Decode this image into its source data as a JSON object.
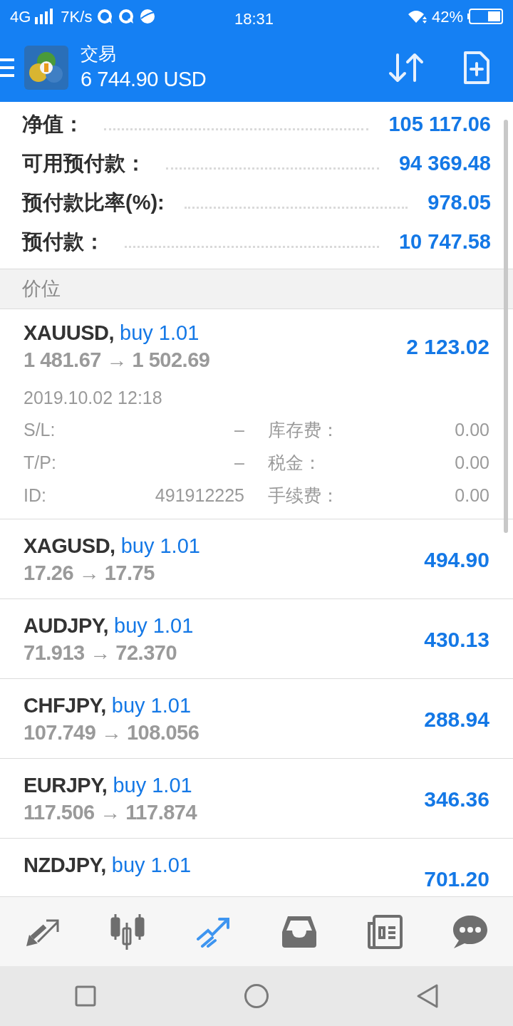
{
  "status_bar": {
    "network": "4G",
    "speed": "7K/s",
    "time": "18:31",
    "battery": "42%"
  },
  "header": {
    "title": "交易",
    "balance": "6 744.90 USD"
  },
  "summary": [
    {
      "label": "净值：",
      "value": "105 117.06"
    },
    {
      "label": "可用预付款：",
      "value": "94 369.48"
    },
    {
      "label": "预付款比率(%):",
      "value": "978.05"
    },
    {
      "label": "预付款：",
      "value": "10 747.58"
    }
  ],
  "section_title": "价位",
  "positions": [
    {
      "symbol": "XAUUSD,",
      "side": "buy 1.01",
      "prices": "1 481.67 → 1 502.69",
      "profit": "2 123.02",
      "expanded": true,
      "time": "2019.10.02 12:18",
      "details": [
        {
          "label": "S/L:",
          "value": "–"
        },
        {
          "label": "库存费：",
          "value": "0.00"
        },
        {
          "label": "T/P:",
          "value": "–"
        },
        {
          "label": "税金：",
          "value": "0.00"
        },
        {
          "label": "ID:",
          "value": "491912225"
        },
        {
          "label": "手续费：",
          "value": "0.00"
        }
      ]
    },
    {
      "symbol": "XAGUSD,",
      "side": "buy 1.01",
      "prices": "17.26 → 17.75",
      "profit": "494.90",
      "expanded": false
    },
    {
      "symbol": "AUDJPY,",
      "side": "buy 1.01",
      "prices": "71.913 → 72.370",
      "profit": "430.13",
      "expanded": false
    },
    {
      "symbol": "CHFJPY,",
      "side": "buy 1.01",
      "prices": "107.749 → 108.056",
      "profit": "288.94",
      "expanded": false
    },
    {
      "symbol": "EURJPY,",
      "side": "buy 1.01",
      "prices": "117.506 → 117.874",
      "profit": "346.36",
      "expanded": false
    },
    {
      "symbol": "NZDJPY,",
      "side": "buy 1.01",
      "profit": "701.20",
      "expanded": false
    }
  ],
  "bottom_nav": [
    {
      "kind": "quotes",
      "selected": false
    },
    {
      "kind": "chart",
      "selected": false
    },
    {
      "kind": "trade",
      "selected": true
    },
    {
      "kind": "history",
      "selected": false
    },
    {
      "kind": "news",
      "selected": false
    },
    {
      "kind": "chat",
      "selected": false
    }
  ]
}
